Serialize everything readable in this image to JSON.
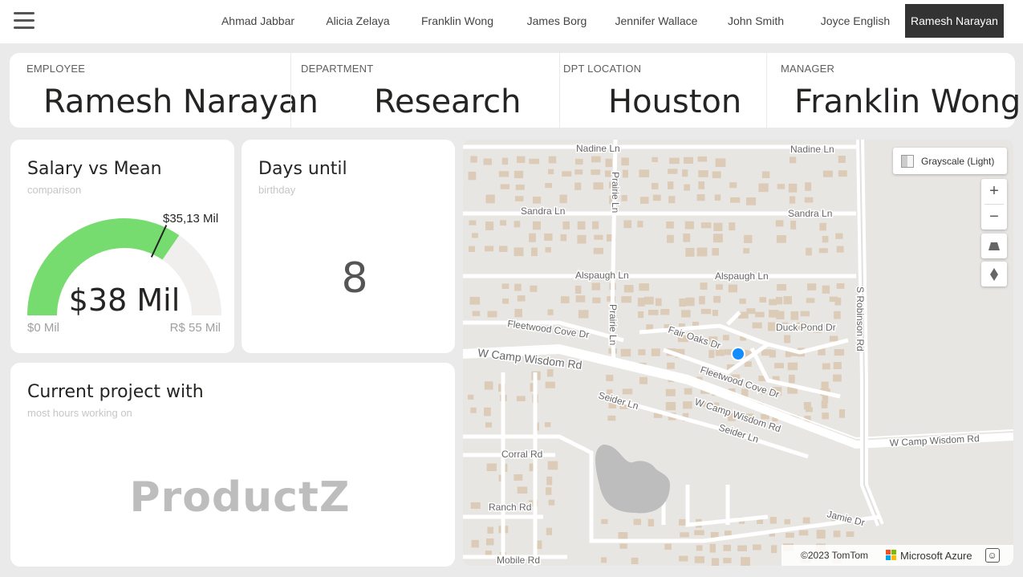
{
  "nav": {
    "menu_icon": "hamburger-menu-icon",
    "employees": [
      "Ahmad Jabbar",
      "Alicia Zelaya",
      "Franklin Wong",
      "James Borg",
      "Jennifer Wallace",
      "John Smith",
      "Joyce English",
      "Ramesh Narayan"
    ],
    "selected": "Ramesh Narayan"
  },
  "kpis": {
    "employee": {
      "label": "EMPLOYEE",
      "value": "Ramesh Narayan"
    },
    "department": {
      "label": "DEPARTMENT",
      "value": "Research"
    },
    "location": {
      "label": "DPT LOCATION",
      "value": "Houston"
    },
    "manager": {
      "label": "MANAGER",
      "value": "Franklin Wong"
    }
  },
  "gauge": {
    "title": "Salary vs Mean",
    "subtitle": "comparison",
    "value_label": "$38 Mil",
    "target_label": "$35,13 Mil",
    "min_label": "$0 Mil",
    "max_label": "R$ 55 Mil",
    "value": 38,
    "target": 35.13,
    "min": 0,
    "max": 55,
    "fill_color": "#76dc6f",
    "track_color": "#f0efed"
  },
  "days": {
    "title": "Days until",
    "subtitle": "birthday",
    "value": "8"
  },
  "project": {
    "title": "Current project with",
    "subtitle": "most hours working on",
    "value": "ProductZ"
  },
  "map": {
    "style_label": "Grayscale (Light)",
    "zoom_in_icon": "plus-icon",
    "zoom_out_icon": "minus-icon",
    "pitch_icon": "pitch-icon",
    "compass_icon": "compass-icon",
    "feedback_icon": "smiley-icon",
    "copyright": "©2023 TomTom",
    "brand": "Microsoft Azure",
    "marker_color": "#118dff",
    "streets": [
      "Nadine Ln",
      "Nadine Ln",
      "Sandra Ln",
      "Sandra Ln",
      "Alspaugh Ln",
      "Alspaugh Ln",
      "Prairie Ln",
      "Prairie Ln",
      "Fleetwood Cove Dr",
      "Fleetwood Cove Dr",
      "Fair Oaks Dr",
      "Duck Pond Dr",
      "W Camp Wisdom Rd",
      "W Camp Wisdom Rd",
      "W Camp Wisdom Rd",
      "Seider Ln",
      "Seider Ln",
      "S Robinson Rd",
      "Corral Rd",
      "Ranch Rd",
      "Jamie Dr",
      "Mobile Rd"
    ]
  }
}
